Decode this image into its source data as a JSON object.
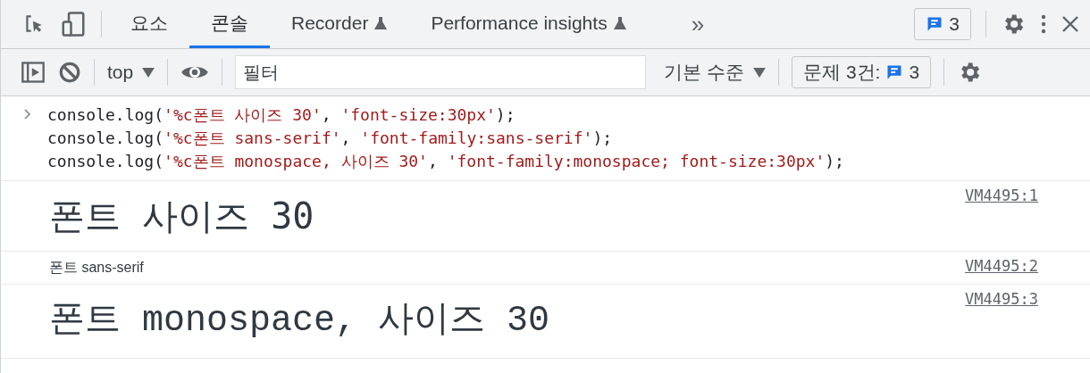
{
  "tabs": [
    {
      "label": "요소",
      "selected": false,
      "experimental": false
    },
    {
      "label": "콘솔",
      "selected": true,
      "experimental": false
    },
    {
      "label": "Recorder",
      "selected": false,
      "experimental": true
    },
    {
      "label": "Performance insights",
      "selected": false,
      "experimental": true
    }
  ],
  "more_tabs": "»",
  "issues_badge": {
    "count": "3"
  },
  "toolbar": {
    "context": "top",
    "filter": {
      "placeholder": "필터"
    },
    "levels": "기본 수준",
    "issues_label": "문제 3건:",
    "issues_count": "3"
  },
  "input_lines": [
    [
      {
        "kind": "plain",
        "text": "console.log("
      },
      {
        "kind": "string",
        "text": "'%c폰트 사이즈 30'"
      },
      {
        "kind": "plain",
        "text": ", "
      },
      {
        "kind": "string",
        "text": "'font-size:30px'"
      },
      {
        "kind": "plain",
        "text": ");"
      }
    ],
    [
      {
        "kind": "plain",
        "text": "console.log("
      },
      {
        "kind": "string",
        "text": "'%c폰트 sans-serif'"
      },
      {
        "kind": "plain",
        "text": ", "
      },
      {
        "kind": "string",
        "text": "'font-family:sans-serif'"
      },
      {
        "kind": "plain",
        "text": ");"
      }
    ],
    [
      {
        "kind": "plain",
        "text": "console.log("
      },
      {
        "kind": "string",
        "text": "'%c폰트 monospace, 사이즈 30'"
      },
      {
        "kind": "plain",
        "text": ", "
      },
      {
        "kind": "string",
        "text": "'font-family:monospace; font-size:30px'"
      },
      {
        "kind": "plain",
        "text": ");"
      }
    ]
  ],
  "messages": [
    {
      "text": "폰트 사이즈 30",
      "kind": "large",
      "source": "VM4495:1"
    },
    {
      "text": "폰트 sans-serif",
      "kind": "sans",
      "source": "VM4495:2"
    },
    {
      "text": "폰트 monospace, 사이즈 30",
      "kind": "large-mono",
      "source": "VM4495:3"
    }
  ]
}
